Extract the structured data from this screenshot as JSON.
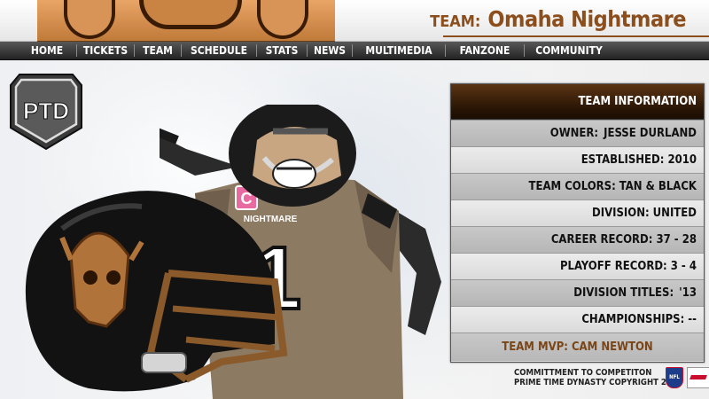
{
  "header": {
    "team_label": "TEAM:",
    "team_name": "Omaha Nightmare"
  },
  "nav": {
    "items": [
      "HOME",
      "TICKETS",
      "TEAM",
      "SCHEDULE",
      "STATS",
      "NEWS",
      "MULTIMEDIA",
      "FANZONE",
      "COMMUNITY"
    ]
  },
  "badge": {
    "text": "PTD"
  },
  "player": {
    "jersey_number": "1",
    "jersey_text": "NIGHTMARE",
    "patch": "C"
  },
  "info": {
    "title": "TEAM INFORMATION",
    "rows": [
      {
        "label": "OWNER:",
        "value": "JESSE DURLAND"
      },
      {
        "label": "ESTABLISHED:",
        "value": "2010"
      },
      {
        "label": "TEAM COLORS:",
        "value": "TAN & BLACK"
      },
      {
        "label": "DIVISION:",
        "value": "UNITED"
      },
      {
        "label": "CAREER RECORD:",
        "value": "37 - 28"
      },
      {
        "label": "PLAYOFF RECORD:",
        "value": "3 - 4"
      },
      {
        "label": "DIVISION TITLES:",
        "value": "'13"
      },
      {
        "label": "CHAMPIONSHIPS:",
        "value": "--"
      }
    ],
    "mvp_label": "TEAM MVP:",
    "mvp_value": "CAM NEWTON"
  },
  "footer": {
    "line1": "COMMITTMENT TO COMPETITON",
    "line2": "PRIME TIME DYNASTY COPYRIGHT 2015",
    "nfl": "NFL"
  },
  "colors": {
    "accent_brown": "#8b4e1c",
    "nav_bg": "#333333",
    "panel_header": "#3a1f0a",
    "mvp_text": "#7a4517"
  }
}
